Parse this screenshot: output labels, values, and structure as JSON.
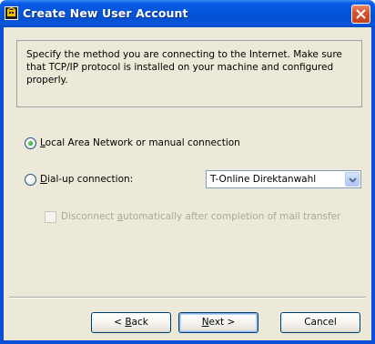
{
  "window": {
    "title": "Create New User Account",
    "icon": "account-wizard-icon",
    "close_icon": "close-icon",
    "accent_color": "#0454d8",
    "close_color": "#d9532c"
  },
  "info": {
    "text": "Specify the method you are connecting to the Internet. Make sure that TCP/IP protocol is installed on your machine and configured properly."
  },
  "options": {
    "lan": {
      "prefix": "",
      "mnemonic": "L",
      "rest": "ocal Area Network or manual connection",
      "selected": true
    },
    "dialup": {
      "prefix": "",
      "mnemonic": "D",
      "rest": "ial-up connection:",
      "selected": false
    },
    "dialup_select_value": "T-Online Direktanwahl",
    "disconnect": {
      "prefix": "Disconnect ",
      "mnemonic": "a",
      "rest": "utomatically after completion of mail transfer",
      "checked": false,
      "enabled": false
    }
  },
  "buttons": {
    "back": {
      "prefix": "< ",
      "mnemonic": "B",
      "rest": "ack"
    },
    "next": {
      "prefix": "",
      "mnemonic": "N",
      "rest": "ext  >"
    },
    "cancel": "Cancel"
  }
}
